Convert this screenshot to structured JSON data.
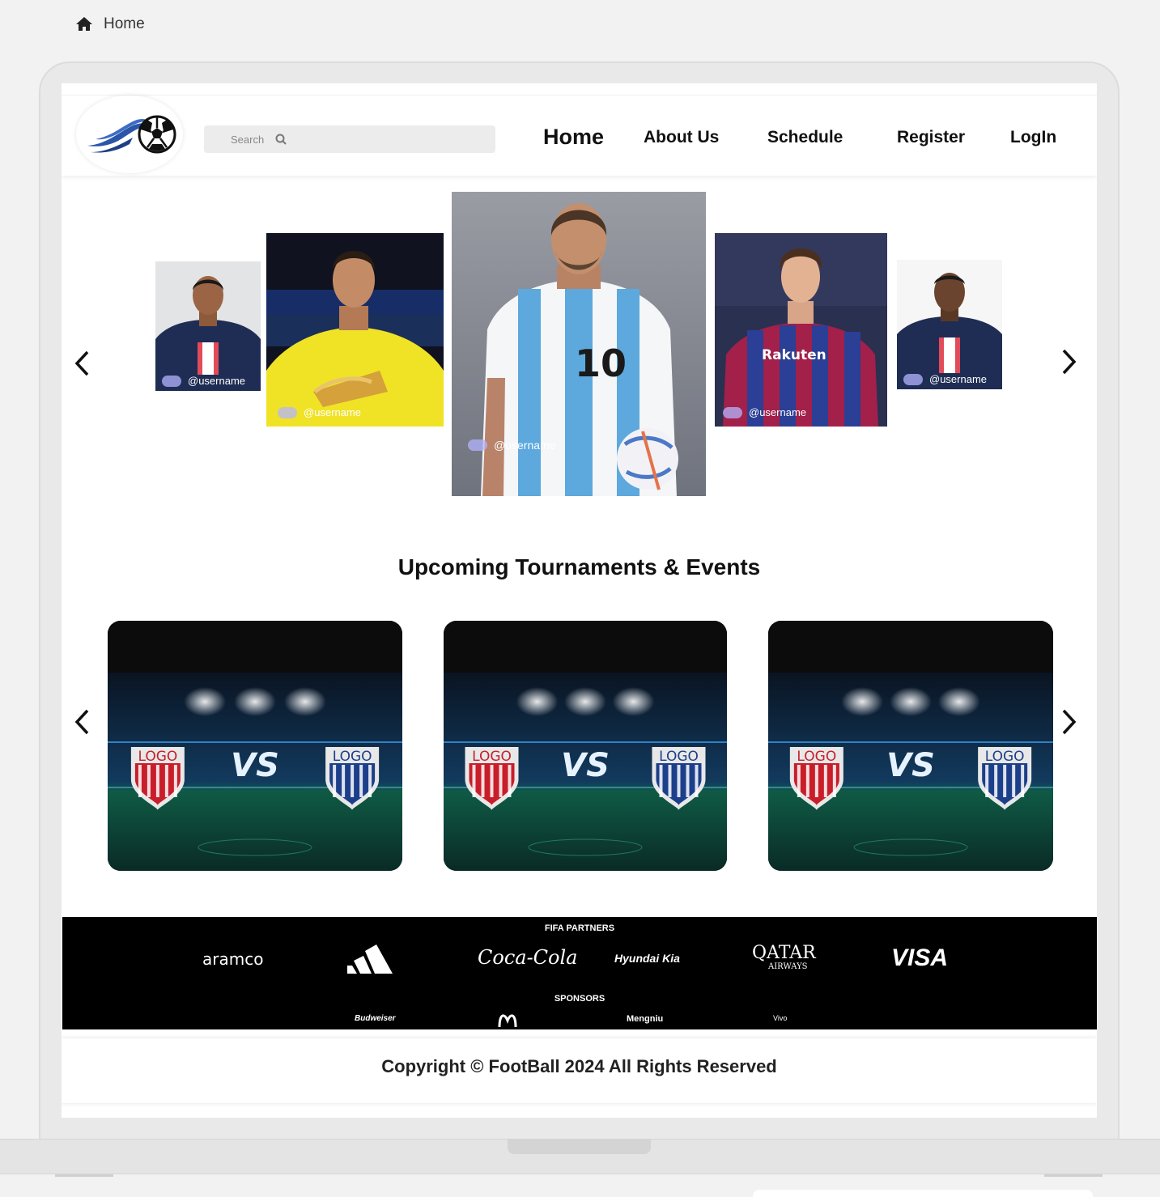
{
  "breadcrumb": {
    "icon": "home-icon",
    "label": "Home"
  },
  "header": {
    "search_placeholder": "Search",
    "nav": [
      {
        "label": "Home"
      },
      {
        "label": "About Us"
      },
      {
        "label": "Schedule"
      },
      {
        "label": "Register"
      },
      {
        "label": "LogIn"
      }
    ]
  },
  "carousel": {
    "handles": [
      "@username",
      "@username",
      "@username",
      "@username",
      "@username"
    ],
    "jersey_numbers": {
      "center": "10"
    }
  },
  "events": {
    "title": "Upcoming Tournaments & Events",
    "cards": [
      {
        "home": "LOGO",
        "vs": "VS",
        "away": "LOGO"
      },
      {
        "home": "LOGO",
        "vs": "VS",
        "away": "LOGO"
      },
      {
        "home": "LOGO",
        "vs": "VS",
        "away": "LOGO"
      }
    ]
  },
  "partners": {
    "title": "FIFA PARTNERS",
    "brands": [
      "aramco",
      "adidas",
      "Coca-Cola",
      "Hyundai Kia",
      "QATAR",
      "AIRWAYS",
      "VISA"
    ],
    "sponsors_title": "SPONSORS",
    "sponsors": [
      "Budweiser",
      "McDonald's",
      "Mengniu",
      "Vivo"
    ]
  },
  "footer": {
    "copyright": "Copyright © FootBall 2024 All Rights Reserved"
  },
  "colors": {
    "accent": "#2a55a8",
    "dark": "#000000",
    "page_bg": "#f2f2f2"
  }
}
